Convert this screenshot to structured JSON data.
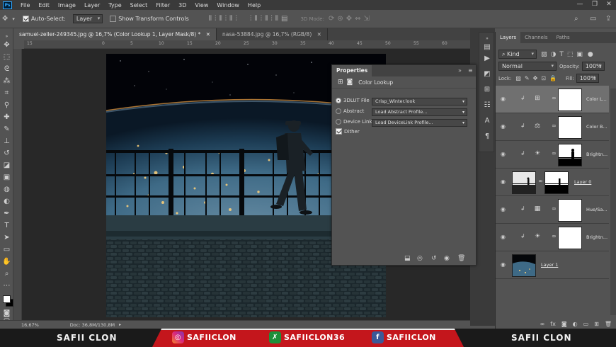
{
  "app": {
    "logo": "Ps",
    "menu": [
      "File",
      "Edit",
      "Image",
      "Layer",
      "Type",
      "Select",
      "Filter",
      "3D",
      "View",
      "Window",
      "Help"
    ],
    "window_controls": [
      "—",
      "❐",
      "✕"
    ]
  },
  "options_bar": {
    "auto_select_label": "Auto-Select:",
    "auto_select_value": "Layer",
    "show_transform_label": "Show Transform Controls",
    "mode_3d_label": "3D Mode:"
  },
  "tabs": [
    {
      "label": "samuel-zeller-249345.jpg @ 16,7% (Color Lookup 1, Layer Mask/8) *",
      "close": "✕",
      "active": true
    },
    {
      "label": "nasa-53884.jpg @ 16,7% (RGB/8)",
      "close": "✕",
      "active": false
    }
  ],
  "ruler_marks": [
    "15",
    "0",
    "5",
    "10",
    "15",
    "20",
    "25",
    "30",
    "35",
    "40",
    "45",
    "50",
    "55",
    "60"
  ],
  "properties": {
    "tab_title": "Properties",
    "header_controls": [
      "»",
      "≡"
    ],
    "subtitle": "Color Lookup",
    "rows": [
      {
        "label": "3DLUT File",
        "value": "Crisp_Winter.look"
      },
      {
        "label": "Abstract",
        "value": "Load Abstract Profile..."
      },
      {
        "label": "Device Link",
        "value": "Load DeviceLink Profile..."
      }
    ],
    "dither_label": "Dither"
  },
  "layers_panel": {
    "tabs": [
      "Layers",
      "Channels",
      "Paths"
    ],
    "kind_label": "Kind",
    "blend_mode": "Normal",
    "opacity_label": "Opacity:",
    "opacity_value": "100%",
    "lock_label": "Lock:",
    "fill_label": "Fill:",
    "fill_value": "100%",
    "layers": [
      {
        "name": "Color L...",
        "thumb": "white",
        "adj_icon": "grid",
        "selected": true
      },
      {
        "name": "Color B...",
        "thumb": "white",
        "adj_icon": "balance",
        "selected": false
      },
      {
        "name": "Brightn...",
        "thumb": "mask-silhouette",
        "adj_icon": "sun",
        "selected": false
      },
      {
        "name": "Layer 0",
        "thumb": "photo",
        "adj_icon": "",
        "selected": false
      },
      {
        "name": "Hue/Sa...",
        "thumb": "white",
        "adj_icon": "hue",
        "selected": false
      },
      {
        "name": "Brightn...",
        "thumb": "white",
        "adj_icon": "sun",
        "selected": false
      },
      {
        "name": "Layer 1",
        "thumb": "earth",
        "adj_icon": "",
        "selected": false
      }
    ],
    "footer_icons": [
      "link-icon",
      "fx-icon",
      "mask-icon",
      "adjustment-icon",
      "folder-icon",
      "new-layer-icon",
      "trash-icon"
    ]
  },
  "status": {
    "zoom": "16,67%",
    "doc": "Doc: 36,8M/130,8M"
  },
  "banner": {
    "left_name": "SAFII CLON",
    "right_name": "SAFII CLON",
    "instagram": "SAFIICLON",
    "other": "SAFIICLON36",
    "facebook": "SAFIICLON",
    "accent": "#c4161c"
  }
}
